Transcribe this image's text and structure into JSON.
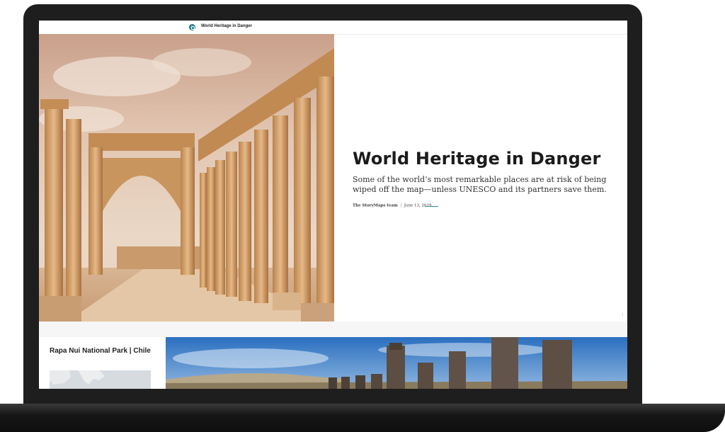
{
  "story": {
    "header_title": "World Heritage in Danger",
    "title": "World Heritage in Danger",
    "subtitle": "Some of the world’s most remarkable places are at risk of being wiped off the map—unless UNESCO and its partners save them.",
    "author": "The StoryMaps team",
    "date": "June 13, 2019"
  },
  "section": {
    "card_title": "Rapa Nui National Park | Chile"
  },
  "icons": {
    "logo": "storymaps-logo-icon"
  },
  "colors": {
    "accent": "#2e8f9a",
    "frame": "#1e1e1e",
    "text": "#1b1b1b"
  }
}
